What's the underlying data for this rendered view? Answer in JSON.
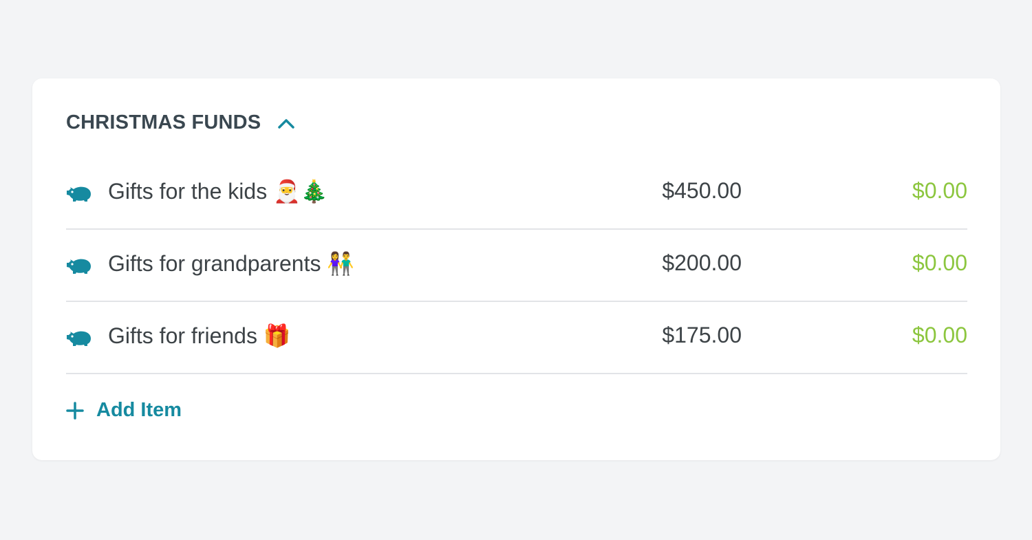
{
  "colors": {
    "accent": "#168aa0",
    "positive": "#8cc63f",
    "text": "#3d4347",
    "title": "#3a4750"
  },
  "group": {
    "title": "CHRISTMAS FUNDS",
    "toggle_icon": "chevron-up-icon"
  },
  "items": [
    {
      "icon": "piggy-bank-icon",
      "name": "Gifts for the kids 🎅🎄",
      "budgeted": "$450.00",
      "remaining": "$0.00"
    },
    {
      "icon": "piggy-bank-icon",
      "name": "Gifts for grandparents 👫",
      "budgeted": "$200.00",
      "remaining": "$0.00"
    },
    {
      "icon": "piggy-bank-icon",
      "name": "Gifts for friends 🎁",
      "budgeted": "$175.00",
      "remaining": "$0.00"
    }
  ],
  "add_item": {
    "icon": "plus-icon",
    "label": "Add Item"
  }
}
